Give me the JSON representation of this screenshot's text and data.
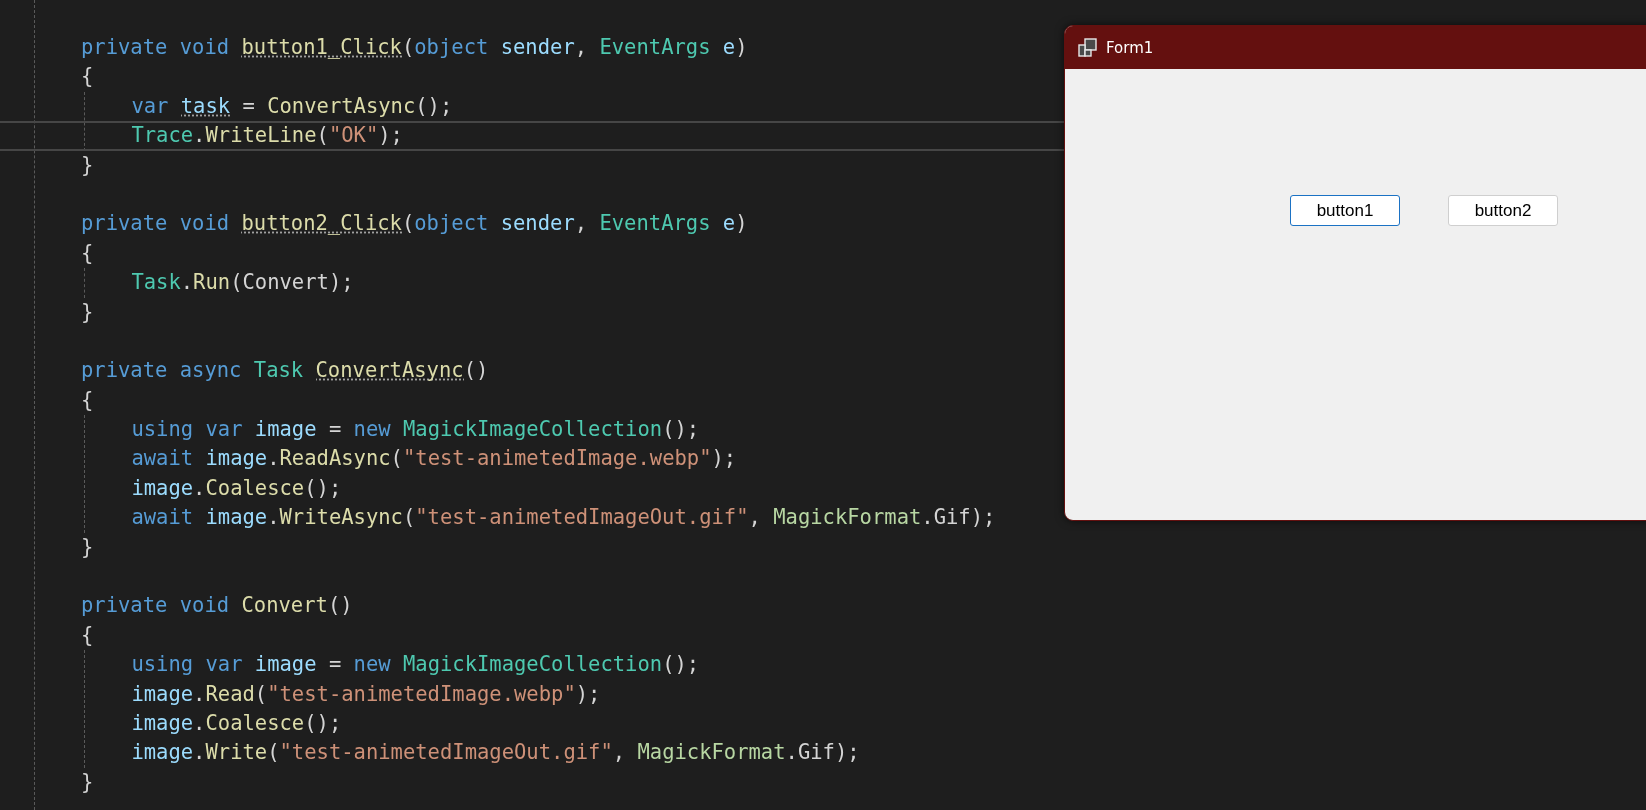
{
  "editor": {
    "methods": [
      {
        "signature": [
          {
            "t": "private ",
            "kind": "kw"
          },
          {
            "t": "void ",
            "kind": "kw"
          },
          {
            "t": "button1_Click",
            "kind": "method",
            "hint": true
          },
          {
            "t": "(",
            "kind": "plain"
          },
          {
            "t": "object ",
            "kind": "kw"
          },
          {
            "t": "sender",
            "kind": "var"
          },
          {
            "t": ", ",
            "kind": "plain"
          },
          {
            "t": "EventArgs ",
            "kind": "type"
          },
          {
            "t": "e",
            "kind": "var"
          },
          {
            "t": ")",
            "kind": "plain"
          }
        ],
        "open": "{",
        "close": "}",
        "body": [
          {
            "current": false,
            "tokens": [
              {
                "t": "var ",
                "kind": "kw"
              },
              {
                "t": "task",
                "kind": "var",
                "hint": true
              },
              {
                "t": " = ",
                "kind": "plain"
              },
              {
                "t": "ConvertAsync",
                "kind": "method"
              },
              {
                "t": "();",
                "kind": "plain"
              }
            ]
          },
          {
            "current": true,
            "tokens": [
              {
                "t": "Trace",
                "kind": "type"
              },
              {
                "t": ".",
                "kind": "plain"
              },
              {
                "t": "WriteLine",
                "kind": "method"
              },
              {
                "t": "(",
                "kind": "plain"
              },
              {
                "t": "\"OK\"",
                "kind": "str"
              },
              {
                "t": ");",
                "kind": "plain"
              }
            ]
          }
        ]
      },
      {
        "signature": [
          {
            "t": "private ",
            "kind": "kw"
          },
          {
            "t": "void ",
            "kind": "kw"
          },
          {
            "t": "button2_Click",
            "kind": "method",
            "hint": true
          },
          {
            "t": "(",
            "kind": "plain"
          },
          {
            "t": "object ",
            "kind": "kw"
          },
          {
            "t": "sender",
            "kind": "var"
          },
          {
            "t": ", ",
            "kind": "plain"
          },
          {
            "t": "EventArgs ",
            "kind": "type"
          },
          {
            "t": "e",
            "kind": "var"
          },
          {
            "t": ")",
            "kind": "plain"
          }
        ],
        "open": "{",
        "close": "}",
        "body": [
          {
            "current": false,
            "tokens": [
              {
                "t": "Task",
                "kind": "type"
              },
              {
                "t": ".",
                "kind": "plain"
              },
              {
                "t": "Run",
                "kind": "method"
              },
              {
                "t": "(Convert);",
                "kind": "plain"
              }
            ]
          }
        ]
      },
      {
        "signature": [
          {
            "t": "private ",
            "kind": "kw"
          },
          {
            "t": "async ",
            "kind": "kw"
          },
          {
            "t": "Task ",
            "kind": "type"
          },
          {
            "t": "ConvertAsync",
            "kind": "method",
            "hint": true
          },
          {
            "t": "()",
            "kind": "plain"
          }
        ],
        "open": "{",
        "close": "}",
        "body": [
          {
            "current": false,
            "tokens": [
              {
                "t": "using ",
                "kind": "kw"
              },
              {
                "t": "var ",
                "kind": "kw"
              },
              {
                "t": "image",
                "kind": "var"
              },
              {
                "t": " = ",
                "kind": "plain"
              },
              {
                "t": "new ",
                "kind": "kw"
              },
              {
                "t": "MagickImageCollection",
                "kind": "type"
              },
              {
                "t": "();",
                "kind": "plain"
              }
            ]
          },
          {
            "current": false,
            "tokens": [
              {
                "t": "await ",
                "kind": "kw"
              },
              {
                "t": "image",
                "kind": "var"
              },
              {
                "t": ".",
                "kind": "plain"
              },
              {
                "t": "ReadAsync",
                "kind": "method"
              },
              {
                "t": "(",
                "kind": "plain"
              },
              {
                "t": "\"test-animetedImage.webp\"",
                "kind": "str"
              },
              {
                "t": ");",
                "kind": "plain"
              }
            ]
          },
          {
            "current": false,
            "tokens": [
              {
                "t": "image",
                "kind": "var"
              },
              {
                "t": ".",
                "kind": "plain"
              },
              {
                "t": "Coalesce",
                "kind": "method"
              },
              {
                "t": "();",
                "kind": "plain"
              }
            ]
          },
          {
            "current": false,
            "tokens": [
              {
                "t": "await ",
                "kind": "kw"
              },
              {
                "t": "image",
                "kind": "var"
              },
              {
                "t": ".",
                "kind": "plain"
              },
              {
                "t": "WriteAsync",
                "kind": "method"
              },
              {
                "t": "(",
                "kind": "plain"
              },
              {
                "t": "\"test-animetedImageOut.gif\"",
                "kind": "str"
              },
              {
                "t": ", ",
                "kind": "plain"
              },
              {
                "t": "MagickFormat",
                "kind": "enum"
              },
              {
                "t": ".Gif);",
                "kind": "plain"
              }
            ]
          }
        ]
      },
      {
        "signature": [
          {
            "t": "private ",
            "kind": "kw"
          },
          {
            "t": "void ",
            "kind": "kw"
          },
          {
            "t": "Convert",
            "kind": "method"
          },
          {
            "t": "()",
            "kind": "plain"
          }
        ],
        "open": "{",
        "close": "}",
        "body": [
          {
            "current": false,
            "tokens": [
              {
                "t": "using ",
                "kind": "kw"
              },
              {
                "t": "var ",
                "kind": "kw"
              },
              {
                "t": "image",
                "kind": "var"
              },
              {
                "t": " = ",
                "kind": "plain"
              },
              {
                "t": "new ",
                "kind": "kw"
              },
              {
                "t": "MagickImageCollection",
                "kind": "type"
              },
              {
                "t": "();",
                "kind": "plain"
              }
            ]
          },
          {
            "current": false,
            "tokens": [
              {
                "t": "image",
                "kind": "var"
              },
              {
                "t": ".",
                "kind": "plain"
              },
              {
                "t": "Read",
                "kind": "method"
              },
              {
                "t": "(",
                "kind": "plain"
              },
              {
                "t": "\"test-animetedImage.webp\"",
                "kind": "str"
              },
              {
                "t": ");",
                "kind": "plain"
              }
            ]
          },
          {
            "current": false,
            "tokens": [
              {
                "t": "image",
                "kind": "var"
              },
              {
                "t": ".",
                "kind": "plain"
              },
              {
                "t": "Coalesce",
                "kind": "method"
              },
              {
                "t": "();",
                "kind": "plain"
              }
            ]
          },
          {
            "current": false,
            "tokens": [
              {
                "t": "image",
                "kind": "var"
              },
              {
                "t": ".",
                "kind": "plain"
              },
              {
                "t": "Write",
                "kind": "method"
              },
              {
                "t": "(",
                "kind": "plain"
              },
              {
                "t": "\"test-animetedImageOut.gif\"",
                "kind": "str"
              },
              {
                "t": ", ",
                "kind": "plain"
              },
              {
                "t": "MagickFormat",
                "kind": "enum"
              },
              {
                "t": ".Gif);",
                "kind": "plain"
              }
            ]
          }
        ]
      }
    ]
  },
  "form_window": {
    "title": "Form1",
    "buttons": [
      {
        "label": "button1",
        "selected": true
      },
      {
        "label": "button2",
        "selected": false
      }
    ]
  }
}
